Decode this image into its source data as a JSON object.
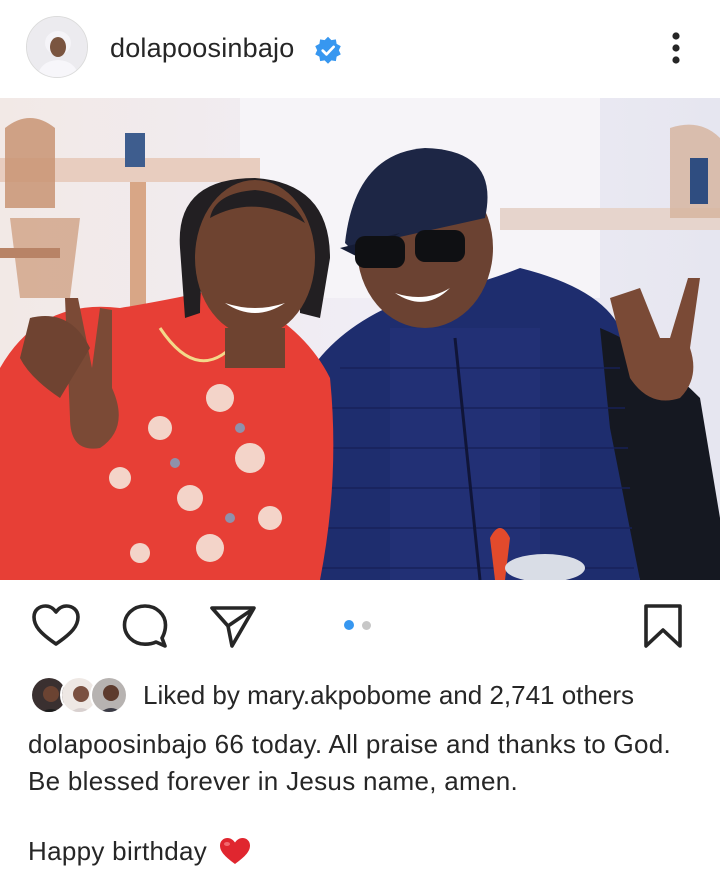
{
  "post": {
    "username": "dolapoosinbajo",
    "verified": true,
    "accent_color": "#3797f0",
    "icons": [
      "heart-outline-icon",
      "comment-bubble-icon",
      "paper-plane-icon",
      "bookmark-icon",
      "more-vertical-icon",
      "verified-badge-icon"
    ]
  },
  "carousel": {
    "total": 2,
    "current": 1
  },
  "likes": {
    "prefix": "Liked by",
    "first_user": "mary.akpobome",
    "middle": "and",
    "count_text": "2,741 others"
  },
  "caption": {
    "username": "dolapoosinbajo",
    "text": "66 today. All praise and thanks to God. Be blessed forever in Jesus name, amen.",
    "line2": "Happy birthday",
    "emoji": "red-heart"
  }
}
